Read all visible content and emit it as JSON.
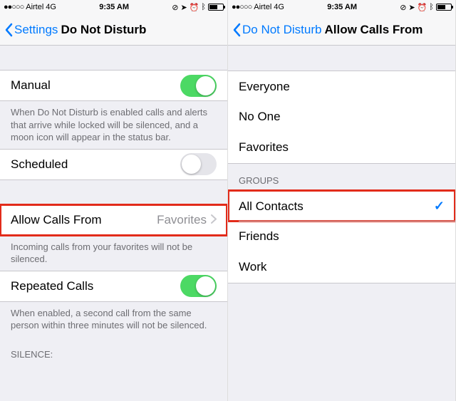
{
  "status": {
    "carrier": "Airtel",
    "network": "4G",
    "time": "9:35 AM",
    "signal_dots": "●●○○○"
  },
  "left": {
    "back_label": "Settings",
    "title": "Do Not Disturb",
    "rows": {
      "manual": {
        "label": "Manual",
        "on": true
      },
      "manual_footer": "When Do Not Disturb is enabled calls and alerts that arrive while locked will be silenced, and a moon icon will appear in the status bar.",
      "scheduled": {
        "label": "Scheduled",
        "on": false
      },
      "allow": {
        "label": "Allow Calls From",
        "value": "Favorites"
      },
      "allow_footer": "Incoming calls from your favorites will not be silenced.",
      "repeated": {
        "label": "Repeated Calls",
        "on": true
      },
      "repeated_footer": "When enabled, a second call from the same person within three minutes will not be silenced.",
      "silence_header": "SILENCE:"
    }
  },
  "right": {
    "back_label": "Do Not Disturb",
    "title": "Allow Calls From",
    "options": [
      "Everyone",
      "No One",
      "Favorites"
    ],
    "groups_header": "GROUPS",
    "groups": [
      "All Contacts",
      "Friends",
      "Work"
    ],
    "selected": "All Contacts"
  },
  "colors": {
    "accent": "#007aff",
    "toggle_on": "#4cd964",
    "highlight": "#e22b1a"
  }
}
